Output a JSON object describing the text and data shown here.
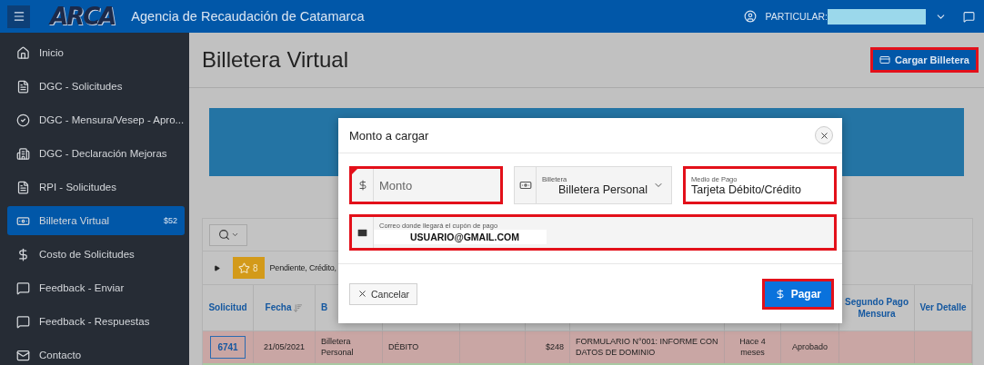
{
  "header": {
    "logo": "ARCA",
    "title": "Agencia de Recaudación de Catamarca",
    "user_label": "PARTICULAR:"
  },
  "sidebar": {
    "items": [
      {
        "label": "Inicio",
        "selected": false
      },
      {
        "label": "DGC - Solicitudes",
        "selected": false
      },
      {
        "label": "DGC - Mensura/Vesep - Apro...",
        "selected": false
      },
      {
        "label": "DGC - Declaración Mejoras",
        "selected": false
      },
      {
        "label": "RPI - Solicitudes",
        "selected": false
      },
      {
        "label": "Billetera Virtual",
        "badge": "$52",
        "selected": true
      },
      {
        "label": "Costo de Solicitudes",
        "selected": false
      },
      {
        "label": "Feedback - Enviar",
        "selected": false
      },
      {
        "label": "Feedback - Respuestas",
        "selected": false
      },
      {
        "label": "Contacto",
        "selected": false
      }
    ]
  },
  "page": {
    "title": "Billetera Virtual",
    "action": {
      "label": "Cargar Billetera",
      "highlighted": true
    }
  },
  "report": {
    "filter_count": "8",
    "filter_text": "Pendiente, Crédito,",
    "columns": [
      {
        "label": "Solicitud",
        "sorted": false
      },
      {
        "label": "Fecha",
        "sorted": true
      },
      {
        "label": "B",
        "sorted": false
      },
      {},
      {},
      {},
      {},
      {},
      {},
      {
        "label": "Segundo Pago Mensura",
        "sorted": false
      },
      {
        "label": "Ver Detalle",
        "sorted": false
      }
    ],
    "rows": [
      {
        "color": "#c9a6a4",
        "cells": [
          {
            "kind": "link",
            "text": "6741"
          },
          {
            "text": "21/05/2021"
          },
          {
            "text": "Billetera Personal"
          },
          {
            "text": "DÉBITO"
          },
          {},
          {
            "text": "$248"
          },
          {
            "text": "FORMULARIO N°001: INFORME CON DATOS DE DOMINIO"
          },
          {
            "text": "Hace 4 meses"
          },
          {
            "text": "Aprobado"
          },
          {},
          {}
        ]
      },
      {
        "color": "#a9c8a2",
        "cells": []
      }
    ]
  },
  "modal": {
    "title": "Monto a cargar",
    "fields": [
      {
        "kind": "amount",
        "placeholder": "Monto",
        "required": true,
        "highlighted": true
      },
      {
        "kind": "select",
        "label": "Billetera",
        "value": "Billetera Personal",
        "highlighted": false
      },
      {
        "kind": "text",
        "label": "Medio de Pago",
        "value": "Tarjeta Débito/Crédito",
        "highlighted": true
      },
      {
        "kind": "email",
        "label": "Correo donde llegará el cupón de pago",
        "value": "USUARIO@GMAIL.COM",
        "highlighted": true
      }
    ],
    "cancel": {
      "label": "Cancelar"
    },
    "submit": {
      "label": "Pagar",
      "highlighted": true
    }
  }
}
